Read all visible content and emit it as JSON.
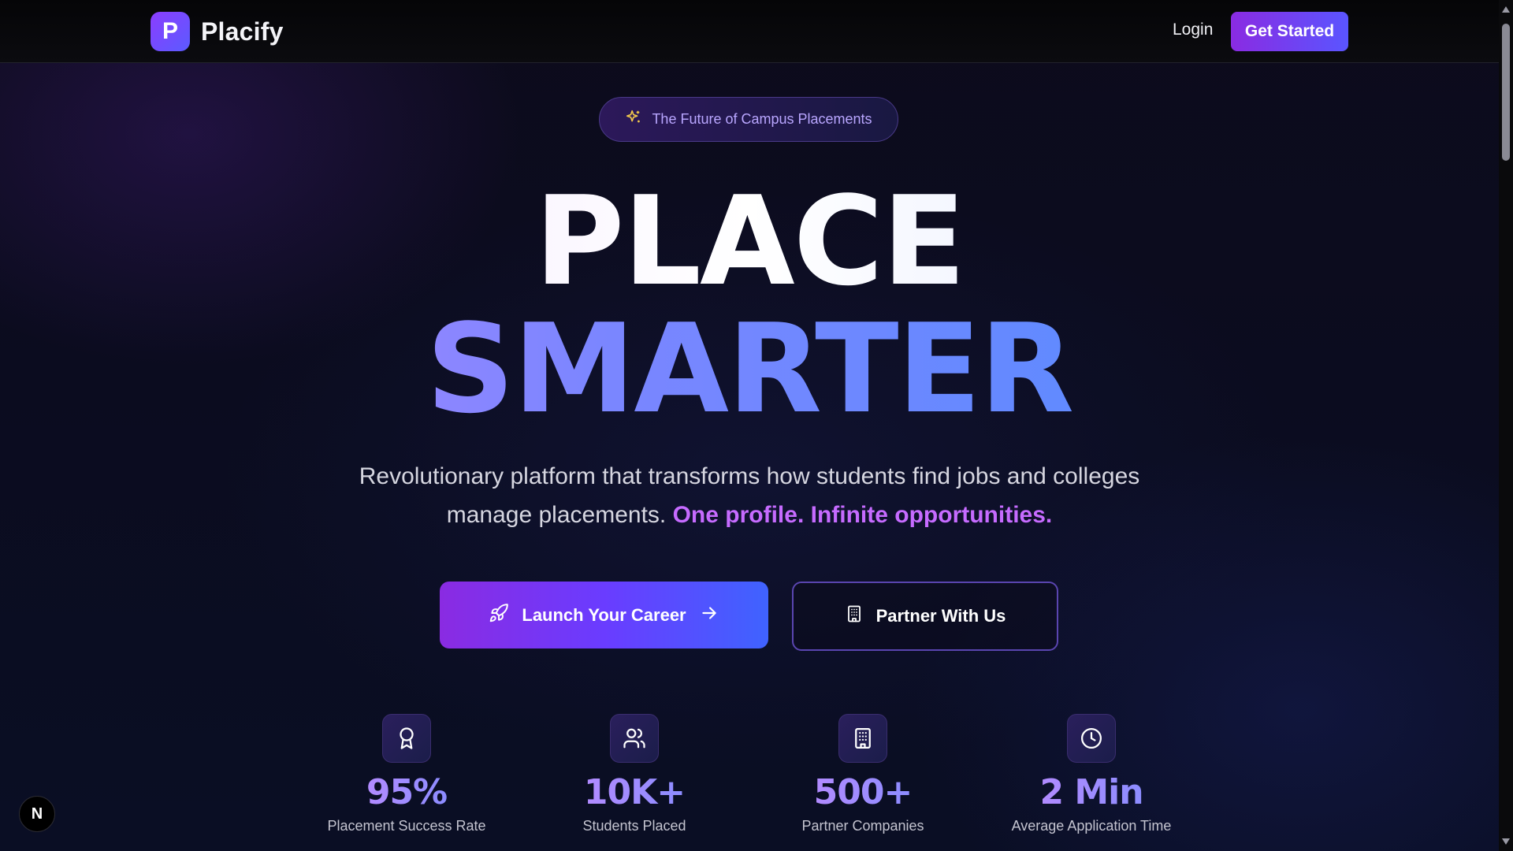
{
  "brand": {
    "logo_letter": "P",
    "name": "Placify"
  },
  "nav": {
    "login_label": "Login",
    "cta_label": "Get Started"
  },
  "hero": {
    "pill_text": "The Future of Campus Placements",
    "headline_line1": "PLACE",
    "headline_line2": "SMARTER",
    "subtitle_line1": "Revolutionary platform that transforms how students find jobs and colleges",
    "subtitle_line2": "manage placements.",
    "subtitle_highlight": "One profile. Infinite opportunities.",
    "primary_cta": "Launch Your Career",
    "secondary_cta": "Partner With Us"
  },
  "stats": [
    {
      "icon": "award-icon",
      "value": "95%",
      "label": "Placement Success Rate"
    },
    {
      "icon": "users-icon",
      "value": "10K+",
      "label": "Students Placed"
    },
    {
      "icon": "building-icon",
      "value": "500+",
      "label": "Partner Companies"
    },
    {
      "icon": "clock-icon",
      "value": "2 Min",
      "label": "Average Application Time"
    }
  ],
  "floating_badge": {
    "label": "N"
  },
  "colors": {
    "accent_purple": "#8a2be2",
    "accent_blue": "#3f63ff",
    "highlight": "#c66bff",
    "background": "#0b0c1f"
  }
}
